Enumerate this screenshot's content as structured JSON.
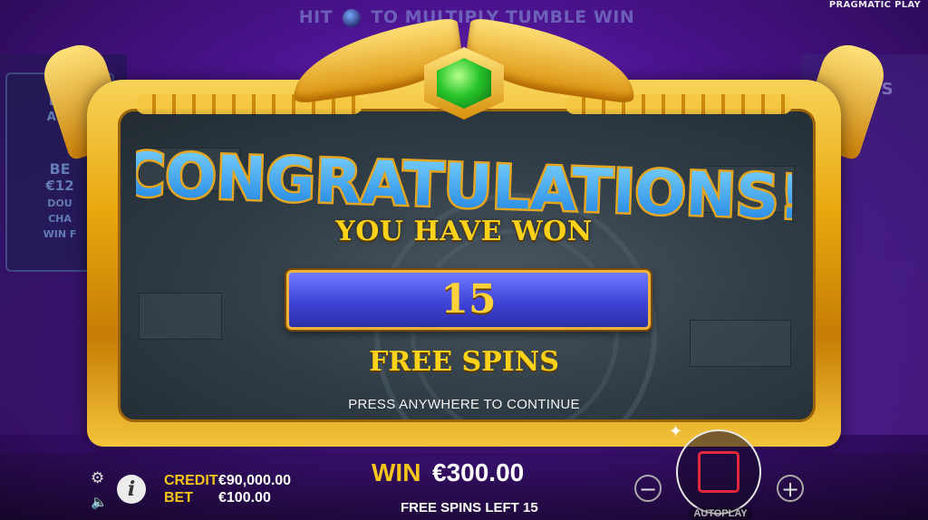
{
  "brand": "PRAGMATIC PLAY",
  "top_banner": {
    "prefix": "HIT",
    "suffix": "TO MULTIPLY TUMBLE WIN"
  },
  "side_panel": {
    "line1": "BO",
    "line2": "ACT",
    "bet": "BE",
    "amount": "€12",
    "line5": "DOU",
    "line6": "CHA",
    "line7": "WIN F"
  },
  "side_panel_right": "US",
  "popup": {
    "title": "CONGRATULATIONS!",
    "you_have_won": "YOU HAVE WON",
    "count": "15",
    "free_spins": "FREE SPINS",
    "continue_hint": "PRESS ANYWHERE TO CONTINUE"
  },
  "status": {
    "credit_label": "CREDIT",
    "credit_value": "€90,000.00",
    "bet_label": "BET",
    "bet_value": "€100.00",
    "win_label": "WIN",
    "win_value": "€300.00",
    "spins_left": "FREE SPINS LEFT 15"
  },
  "controls": {
    "minus": "−",
    "plus": "+",
    "autoplay": "AUTOPLAY"
  },
  "colors": {
    "gold": "#f5c518",
    "frame_gold": "#e9a80f",
    "title_blue": "#29a8ff",
    "bar_blue": "#3f44d8",
    "stop_red": "#e2283a",
    "background_purple": "#4b148f"
  },
  "icons": [
    "settings-gear-icon",
    "sound-icon",
    "info-icon",
    "stop-icon",
    "emerald-gem-icon"
  ]
}
